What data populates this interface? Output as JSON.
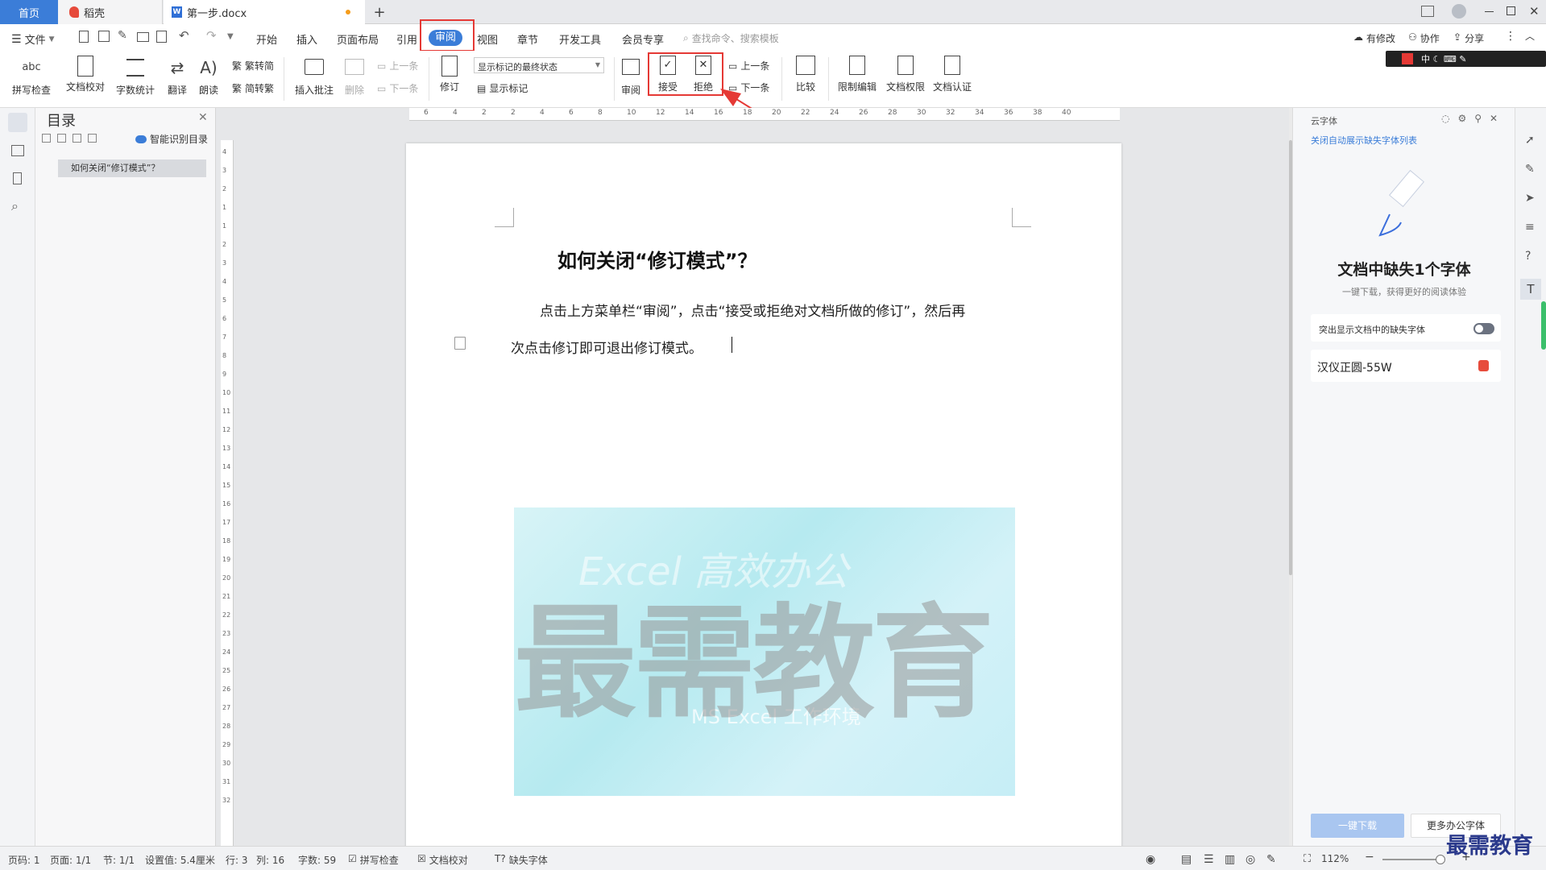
{
  "tabs": {
    "home": "首页",
    "daoke": "稻壳",
    "doc": "第一步.docx",
    "new_tab": "+"
  },
  "menu": {
    "file": "文件",
    "items": [
      "开始",
      "插入",
      "页面布局",
      "引用",
      "审阅",
      "视图",
      "章节",
      "开发工具",
      "会员专享"
    ],
    "search_placeholder": "查找命令、搜索模板",
    "right": [
      "有修改",
      "协作",
      "分享"
    ]
  },
  "ribbon": {
    "spellcheck": "拼写检查",
    "proof": "文档校对",
    "wordcount": "字数统计",
    "translate": "翻译",
    "read": "朗读",
    "trad_to_simp": "繁转简",
    "simp_to_trad": "简转繁",
    "insert_comment": "插入批注",
    "delete": "删除",
    "prev_comment": "上一条",
    "next_comment": "下一条",
    "revise": "修订",
    "markup_state": "显示标记的最终状态",
    "show_markup": "显示标记",
    "review": "审阅",
    "accept": "接受",
    "reject": "拒绝",
    "prev_change": "上一条",
    "next_change": "下一条",
    "compare": "比较",
    "restrict_edit": "限制编辑",
    "doc_permission": "文档权限",
    "doc_cert": "文档认证"
  },
  "toc": {
    "title": "目录",
    "smart": "智能识别目录",
    "item": "如何关闭“修订模式”？"
  },
  "ruler": {
    "h": [
      "6",
      "4",
      "2",
      "2",
      "4",
      "6",
      "8",
      "10",
      "12",
      "14",
      "16",
      "18",
      "20",
      "22",
      "24",
      "26",
      "28",
      "30",
      "32",
      "34",
      "36",
      "38",
      "40"
    ],
    "v": [
      "4",
      "3",
      "2",
      "1",
      "1",
      "2",
      "3",
      "4",
      "5",
      "6",
      "7",
      "8",
      "9",
      "10",
      "11",
      "12",
      "13",
      "14",
      "15",
      "16",
      "17",
      "18",
      "19",
      "20",
      "21",
      "22",
      "23",
      "24",
      "25",
      "26",
      "27",
      "28",
      "29",
      "30",
      "31",
      "32"
    ]
  },
  "document": {
    "heading": "如何关闭“修订模式”？",
    "para1": "点击上方菜单栏“审阅”，点击“接受或拒绝对文档所做的修订”，然后再",
    "para2": "次点击修订即可退出修订模式。",
    "watermark_main": "最需教育",
    "watermark_sub": "Excel 高效办公",
    "watermark_sub2": "MS Excel 工作环境"
  },
  "right_panel": {
    "title": "云字体",
    "link": "关闭自动展示缺失字体列表",
    "heading": "文档中缺失1个字体",
    "sub": "一键下载，获得更好的阅读体验",
    "toggle_label": "突出显示文档中的缺失字体",
    "font_name": "汉仪正圆-55W",
    "download": "一键下载",
    "more": "更多办公字体"
  },
  "status": {
    "page": "页码: 1",
    "pages": "页面: 1/1",
    "section": "节: 1/1",
    "setting": "设置值: 5.4厘米",
    "row": "行: 3",
    "col": "列: 16",
    "words": "字数: 59",
    "spell": "拼写检查",
    "proof": "文档校对",
    "missing_font": "缺失字体",
    "zoom": "112%"
  },
  "corner_watermark": "最需教育",
  "colors": {
    "accent": "#3b7dd8",
    "red": "#e53935"
  }
}
